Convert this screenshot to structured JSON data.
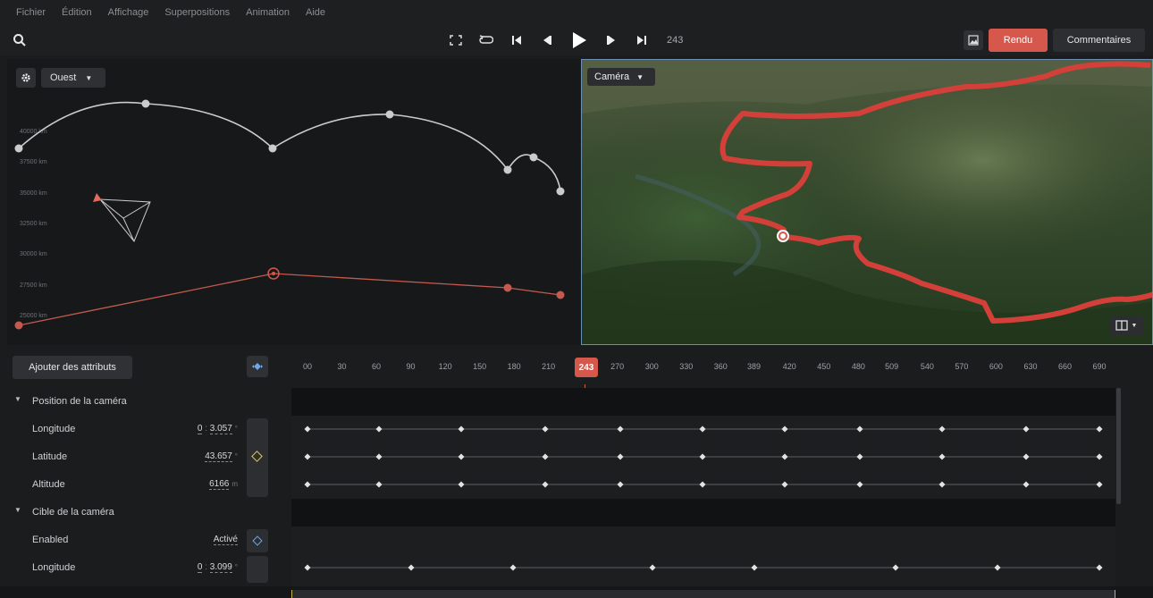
{
  "menu": [
    "Fichier",
    "Édition",
    "Affichage",
    "Superpositions",
    "Animation",
    "Aide"
  ],
  "toolbar": {
    "frame": "243",
    "render_label": "Rendu",
    "comments_label": "Commentaires",
    "icons": [
      "search-icon",
      "fullscreen-icon",
      "loop-icon",
      "skip-start-icon",
      "step-back-icon",
      "play-icon",
      "step-forward-icon",
      "skip-end-icon",
      "image-icon"
    ]
  },
  "plot": {
    "view_label": "Ouest",
    "y_ticks": [
      "40000 km",
      "37500 km",
      "35000 km",
      "32500 km",
      "30000 km",
      "27500 km",
      "25000 km"
    ]
  },
  "map": {
    "camera_label": "Caméra"
  },
  "timeline": {
    "add_attributes_label": "Ajouter des attributs",
    "ticks": [
      "00",
      "30",
      "60",
      "90",
      "120",
      "150",
      "180",
      "210",
      "270",
      "300",
      "330",
      "360",
      "389",
      "420",
      "450",
      "480",
      "509",
      "540",
      "570",
      "600",
      "630",
      "660",
      "690"
    ],
    "playhead": "243",
    "groups": [
      {
        "label": "Position de la caméra",
        "rows": [
          {
            "label": "Longitude",
            "prefix": "0",
            "value": "3.057",
            "unit": "°"
          },
          {
            "label": "Latitude",
            "value": "43.657",
            "unit": "°"
          },
          {
            "label": "Altitude",
            "value": "6166",
            "unit": "m"
          }
        ]
      },
      {
        "label": "Cible de la caméra",
        "rows": [
          {
            "label": "Enabled",
            "value": "Activé"
          },
          {
            "label": "Longitude",
            "prefix": "0",
            "value": "3.099",
            "unit": "°"
          }
        ]
      }
    ]
  },
  "colors": {
    "accent": "#d6574c",
    "playhead": "#d0614f",
    "keyframe_active": "#e6c84a",
    "keyframe_blue": "#6fa8e8"
  }
}
